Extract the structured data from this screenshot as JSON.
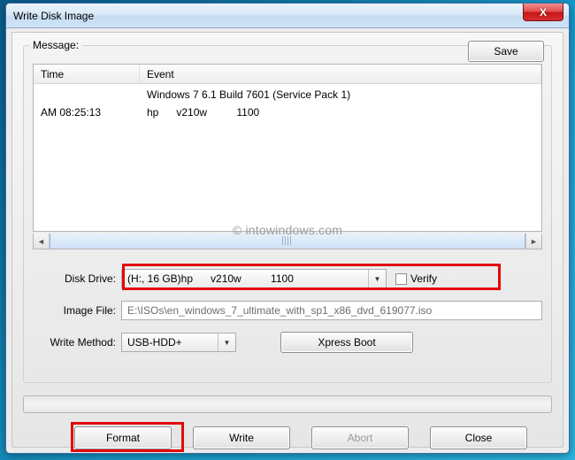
{
  "window": {
    "title": "Write Disk Image",
    "close": "X"
  },
  "message": {
    "label": "Message:",
    "save": "Save",
    "columns": {
      "time": "Time",
      "event": "Event"
    },
    "rows": [
      {
        "time": "",
        "event": "Windows 7 6.1 Build 7601 (Service Pack 1)"
      },
      {
        "time": "AM 08:25:13",
        "event": "hp      v210w          1100"
      }
    ]
  },
  "form": {
    "disk_drive": {
      "label": "Disk Drive:",
      "value": "(H:, 16 GB)hp      v210w          1100",
      "verify_label": "Verify"
    },
    "image_file": {
      "label": "Image File:",
      "value": "E:\\ISOs\\en_windows_7_ultimate_with_sp1_x86_dvd_619077.iso"
    },
    "write_method": {
      "label": "Write Method:",
      "value": "USB-HDD+",
      "xpress": "Xpress Boot"
    }
  },
  "buttons": {
    "format": "Format",
    "write": "Write",
    "abort": "Abort",
    "close": "Close"
  },
  "watermark": "© intowindows.com"
}
